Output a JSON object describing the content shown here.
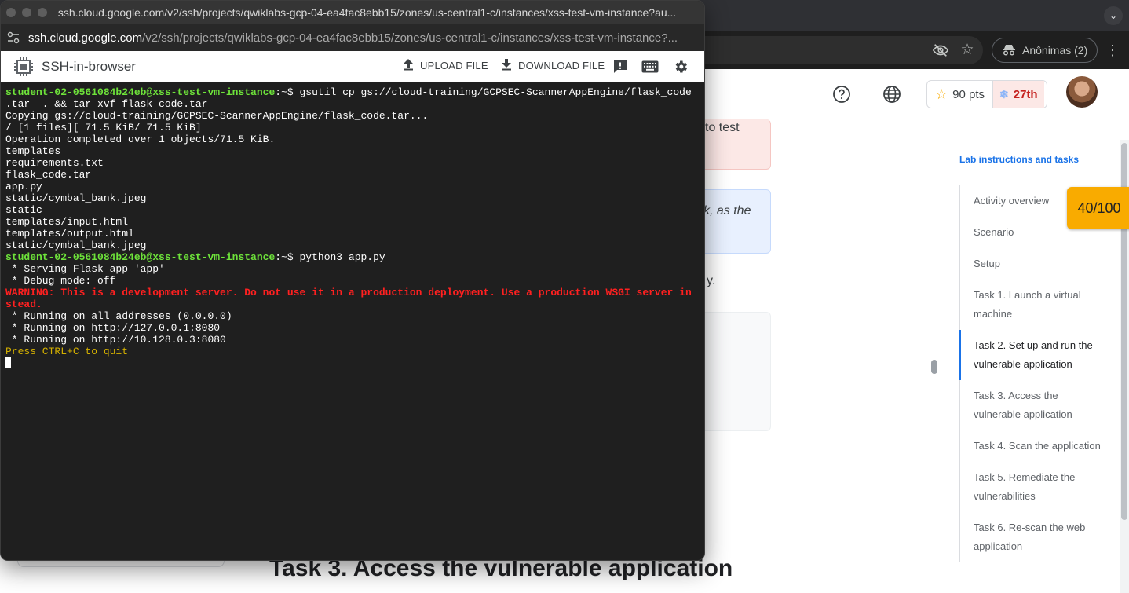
{
  "browser": {
    "incognito_label": "Anônimas (2)"
  },
  "header": {
    "points": "90 pts",
    "rank": "27th"
  },
  "page": {
    "card_red_fragment": "to test",
    "card_blue_fragment": "k, as the",
    "body_fragment": "y.",
    "section_heading": "Task 3. Access the vulnerable application"
  },
  "lab_nav": {
    "title": "Lab instructions and tasks",
    "score": "40/100",
    "items": [
      {
        "label": "Activity overview",
        "active": false
      },
      {
        "label": "Scenario",
        "active": false
      },
      {
        "label": "Setup",
        "active": false
      },
      {
        "label": "Task 1. Launch a virtual machine",
        "active": false
      },
      {
        "label": "Task 2. Set up and run the vulnerable application",
        "active": true
      },
      {
        "label": "Task 3. Access the vulnerable application",
        "active": false
      },
      {
        "label": "Task 4. Scan the application",
        "active": false
      },
      {
        "label": "Task 5. Remediate the vulnerabilities",
        "active": false
      },
      {
        "label": "Task 6. Re-scan the web application",
        "active": false
      }
    ]
  },
  "ssh_window": {
    "title": "ssh.cloud.google.com/v2/ssh/projects/qwiklabs-gcp-04-ea4fac8ebb15/zones/us-central1-c/instances/xss-test-vm-instance?au...",
    "url_host": "ssh.cloud.google.com",
    "url_path": "/v2/ssh/projects/qwiklabs-gcp-04-ea4fac8ebb15/zones/us-central1-c/instances/xss-test-vm-instance?...",
    "app_title": "SSH-in-browser",
    "upload_label": "UPLOAD FILE",
    "download_label": "DOWNLOAD FILE"
  },
  "terminal": {
    "lines": [
      {
        "type": "prompt",
        "user": "student-02-0561084b24eb@xss-test-vm-instance",
        "path": ":~$ ",
        "cmd": "gsutil cp gs://cloud-training/GCPSEC-ScannerAppEngine/flask_code"
      },
      {
        "type": "out",
        "text": ".tar  . && tar xvf flask_code.tar"
      },
      {
        "type": "out",
        "text": "Copying gs://cloud-training/GCPSEC-ScannerAppEngine/flask_code.tar..."
      },
      {
        "type": "out",
        "text": "/ [1 files][ 71.5 KiB/ 71.5 KiB]"
      },
      {
        "type": "out",
        "text": "Operation completed over 1 objects/71.5 KiB."
      },
      {
        "type": "out",
        "text": "templates"
      },
      {
        "type": "out",
        "text": "requirements.txt"
      },
      {
        "type": "out",
        "text": "flask_code.tar"
      },
      {
        "type": "out",
        "text": "app.py"
      },
      {
        "type": "out",
        "text": "static/cymbal_bank.jpeg"
      },
      {
        "type": "out",
        "text": "static"
      },
      {
        "type": "out",
        "text": "templates/input.html"
      },
      {
        "type": "out",
        "text": "templates/output.html"
      },
      {
        "type": "out",
        "text": "static/cymbal_bank.jpeg"
      },
      {
        "type": "prompt",
        "user": "student-02-0561084b24eb@xss-test-vm-instance",
        "path": ":~$ ",
        "cmd": "python3 app.py"
      },
      {
        "type": "out",
        "text": " * Serving Flask app 'app'"
      },
      {
        "type": "out",
        "text": " * Debug mode: off"
      },
      {
        "type": "warn",
        "text": "WARNING: This is a development server. Do not use it in a production deployment. Use a production WSGI server in"
      },
      {
        "type": "warn",
        "text": "stead."
      },
      {
        "type": "out",
        "text": " * Running on all addresses (0.0.0.0)"
      },
      {
        "type": "out",
        "text": " * Running on http://127.0.0.1:8080"
      },
      {
        "type": "out",
        "text": " * Running on http://10.128.0.3:8080"
      },
      {
        "type": "yellow",
        "text": "Press CTRL+C to quit"
      },
      {
        "type": "cursor",
        "text": ""
      }
    ]
  }
}
